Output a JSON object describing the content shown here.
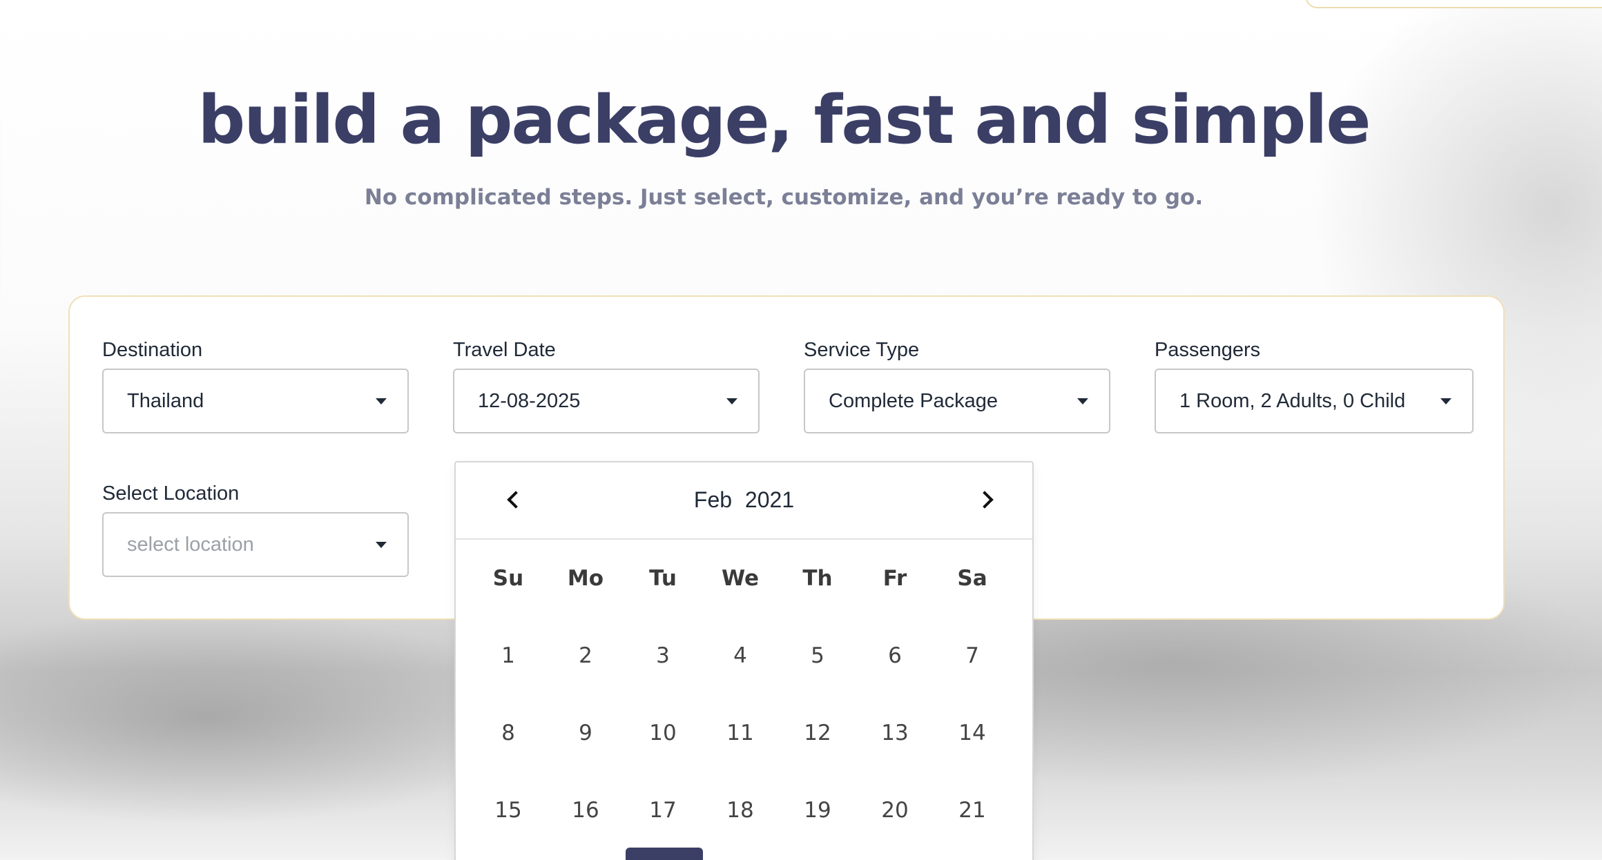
{
  "hero": {
    "title": "build a package, fast and simple",
    "subtitle": "No complicated steps. Just select, customize, and you’re ready to go."
  },
  "form": {
    "destination": {
      "label": "Destination",
      "value": "Thailand"
    },
    "travel_date": {
      "label": "Travel Date",
      "value": "12-08-2025"
    },
    "service_type": {
      "label": "Service Type",
      "value": "Complete Package"
    },
    "passengers": {
      "label": "Passengers",
      "value": "1 Room, 2 Adults, 0 Child"
    },
    "location": {
      "label": "Select Location",
      "placeholder": "select location"
    }
  },
  "calendar": {
    "month": "Feb",
    "year": "2021",
    "weekdays": [
      "Su",
      "Mo",
      "Tu",
      "We",
      "Th",
      "Fr",
      "Sa"
    ],
    "weeks": [
      [
        "1",
        "2",
        "3",
        "4",
        "5",
        "6",
        "7"
      ],
      [
        "8",
        "9",
        "10",
        "11",
        "12",
        "13",
        "14"
      ],
      [
        "15",
        "16",
        "17",
        "18",
        "19",
        "20",
        "21"
      ]
    ],
    "prev_icon": "chevron-left-icon",
    "next_icon": "chevron-right-icon"
  },
  "colors": {
    "heading": "#3b3f66",
    "subheading": "#7b7f96",
    "card_border": "#f1e0b8",
    "selected_day": "#3b3f66"
  }
}
